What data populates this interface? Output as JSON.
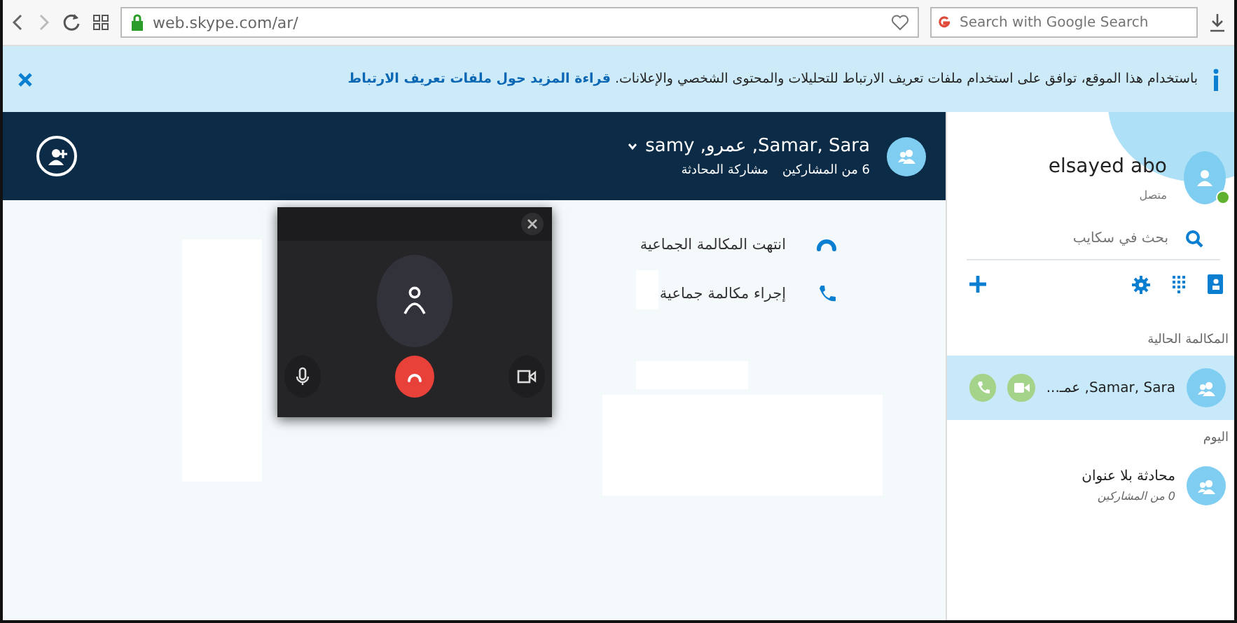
{
  "browser": {
    "url": "web.skype.com/ar/",
    "search_placeholder": "Search with Google Search"
  },
  "banner": {
    "text": "باستخدام هذا الموقع، توافق على استخدام ملفات تعريف الارتباط للتحليلات والمحتوى الشخصي والإعلانات.",
    "link": "قراءة المزيد حول ملفات تعريف الارتباط"
  },
  "conversation": {
    "title": "Samar, Sara, عمرو, samy",
    "participants": "6 من المشاركين",
    "share": "مشاركة المحادثة"
  },
  "actions": [
    {
      "kind": "ended",
      "label": "انتهت المكالمة الجماعية"
    },
    {
      "kind": "call",
      "label": "إجراء مكالمة جماعية"
    }
  ],
  "call_window": {
    "muted": false
  },
  "sidebar": {
    "profile": {
      "name": "elsayed abo",
      "status": "متصل",
      "online": true
    },
    "search": {
      "placeholder": "بحث في سكايب"
    },
    "sections": [
      {
        "heading": "المكالمة الحالية",
        "items": [
          {
            "title": "Samar, Sara, عمـ...",
            "selected": true,
            "in_call": true
          }
        ]
      },
      {
        "heading": "اليوم",
        "items": [
          {
            "title": "محادثة بلا عنوان",
            "subtitle": "0 من المشاركين",
            "selected": false,
            "in_call": false
          }
        ]
      }
    ]
  }
}
